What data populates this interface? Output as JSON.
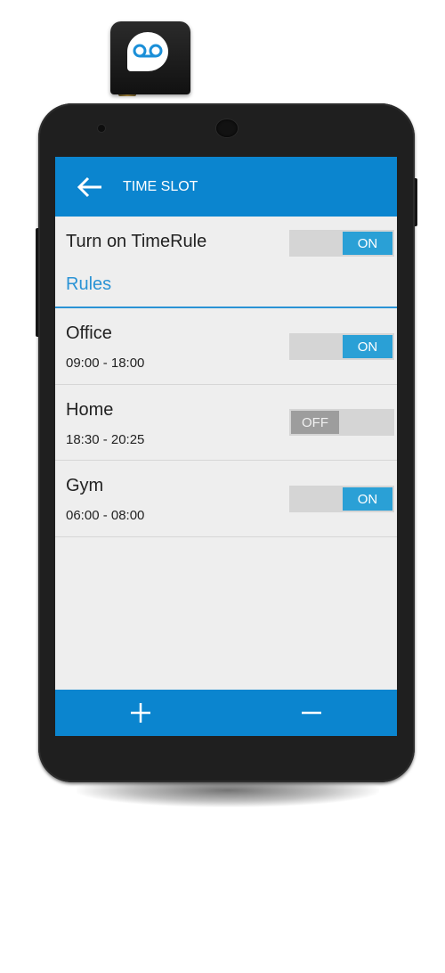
{
  "appbar": {
    "title": "TIME SLOT"
  },
  "master": {
    "label": "Turn on TimeRule",
    "state": "ON"
  },
  "section": {
    "label": "Rules"
  },
  "rules": [
    {
      "name": "Office",
      "time": "09:00 - 18:00",
      "state": "ON"
    },
    {
      "name": "Home",
      "time": "18:30 - 20:25",
      "state": "OFF"
    },
    {
      "name": "Gym",
      "time": "06:00 - 08:00",
      "state": "ON"
    }
  ],
  "colors": {
    "primary": "#0b85cf",
    "accent": "#2a93d5",
    "toggle_on": "#2aa0d6",
    "toggle_off": "#9d9d9d"
  },
  "icons": {
    "back": "arrow-left-icon",
    "add": "plus-icon",
    "remove": "minus-icon",
    "dongle": "voicemail-icon"
  }
}
